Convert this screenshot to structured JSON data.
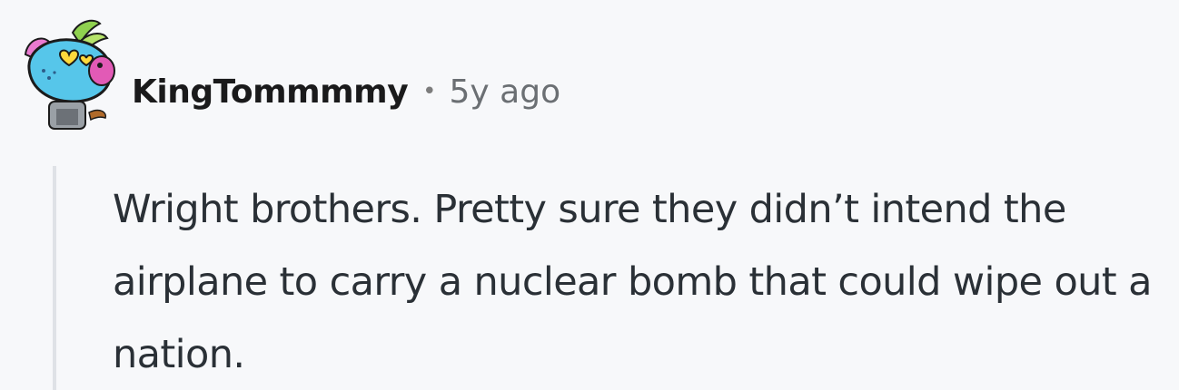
{
  "comment": {
    "author": "KingTommmmy",
    "separator": "•",
    "age": "5y ago",
    "avatar_icon": "snoo-avatar-icon",
    "body": "Wright brothers. Pretty sure they didn’t intend the airplane to carry a nuclear bomb that could wipe out a nation."
  },
  "colors": {
    "background": "#f7f8fa",
    "username": "#1a1a1b",
    "meta": "#6b6f73",
    "body_text": "#2a3036",
    "thread_line": "#dfe2e6"
  }
}
